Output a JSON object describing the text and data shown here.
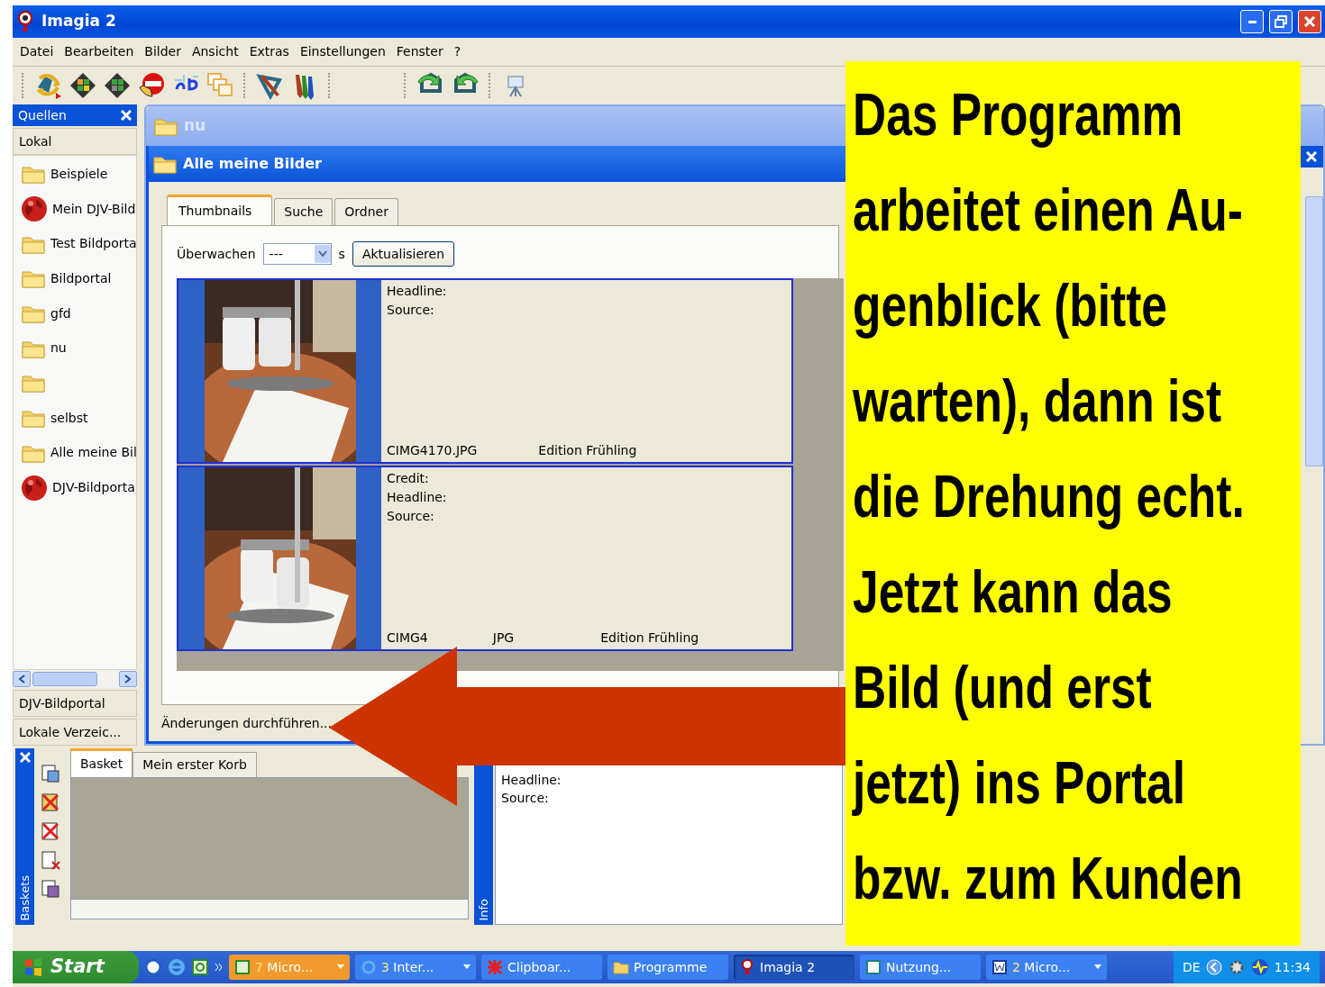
{
  "window": {
    "title": "Imagia 2"
  },
  "menu": [
    "Datei",
    "Bearbeiten",
    "Bilder",
    "Ansicht",
    "Extras",
    "Einstellungen",
    "Fenster",
    "?"
  ],
  "sources_panel": {
    "title": "Quellen",
    "section": "Lokal",
    "items": [
      {
        "label": "Beispiele",
        "kind": "folder"
      },
      {
        "label": "Mein DJV-Bild",
        "kind": "portal"
      },
      {
        "label": "Test Bildporta",
        "kind": "folder"
      },
      {
        "label": "Bildportal",
        "kind": "folder"
      },
      {
        "label": "gfd",
        "kind": "folder"
      },
      {
        "label": "nu",
        "kind": "folder"
      },
      {
        "kind": "folder"
      },
      {
        "label": "selbst",
        "kind": "folder"
      },
      {
        "label": "Alle meine Bil",
        "kind": "folder"
      },
      {
        "label": "DJV-Bildporta",
        "kind": "portal"
      }
    ],
    "sections": [
      "DJV-Bildportal",
      "Lokale Verzeic..."
    ]
  },
  "folder_window": {
    "title": "nu"
  },
  "album_window": {
    "title": "Alle meine Bilder",
    "tabs": [
      {
        "label": "Thumbnails",
        "selected": true
      },
      {
        "label": "Suche",
        "selected": false
      },
      {
        "label": "Ordner",
        "selected": false
      }
    ],
    "monitor": {
      "label": "Überwachen",
      "value": "---",
      "unit": "s"
    },
    "refresh_button": "Aktualisieren",
    "images": [
      {
        "fields": [
          "Headline:",
          "Source:"
        ],
        "filename_parts": [
          "CIMG4170.JPG"
        ],
        "edition": "Edition Frühling"
      },
      {
        "fields": [
          "Credit:",
          "Headline:",
          "Source:"
        ],
        "filename_parts": [
          "CIMG4",
          "JPG"
        ],
        "edition": "Edition Frühling"
      }
    ],
    "status": "Änderungen durchführen..."
  },
  "baskets_panel": {
    "title": "Baskets",
    "tabs": [
      {
        "label": "Basket",
        "selected": true
      },
      {
        "label": "Mein erster Korb",
        "selected": false
      }
    ]
  },
  "info_panel": {
    "title": "Info",
    "fields": [
      "Headline:",
      "Source:"
    ]
  },
  "callout": {
    "lines": [
      "Das Programm",
      "arbeitet einen Au-",
      "genblick (bitte",
      "warten), dann ist",
      "die Drehung echt.",
      "Jetzt kann das",
      "Bild (und erst",
      "jetzt) ins Portal",
      "bzw. zum Kunden"
    ]
  },
  "taskbar": {
    "start": "Start",
    "tasks": [
      {
        "count": "7",
        "label": "Micro...",
        "group": true,
        "flashing": true,
        "selected": false
      },
      {
        "count": "3",
        "label": "Inter...",
        "group": true,
        "flashing": false,
        "selected": false
      },
      {
        "label": "Clipboar...",
        "group": false,
        "flashing": false,
        "selected": false
      },
      {
        "label": "Programme",
        "group": false,
        "flashing": false,
        "selected": false
      },
      {
        "label": "Imagia 2",
        "group": false,
        "flashing": false,
        "selected": true
      },
      {
        "label": "Nutzung...",
        "group": false,
        "flashing": false,
        "selected": false
      },
      {
        "count": "2",
        "label": "Micro...",
        "group": true,
        "flashing": false,
        "selected": false
      }
    ],
    "language": "DE",
    "clock": "11:34"
  }
}
